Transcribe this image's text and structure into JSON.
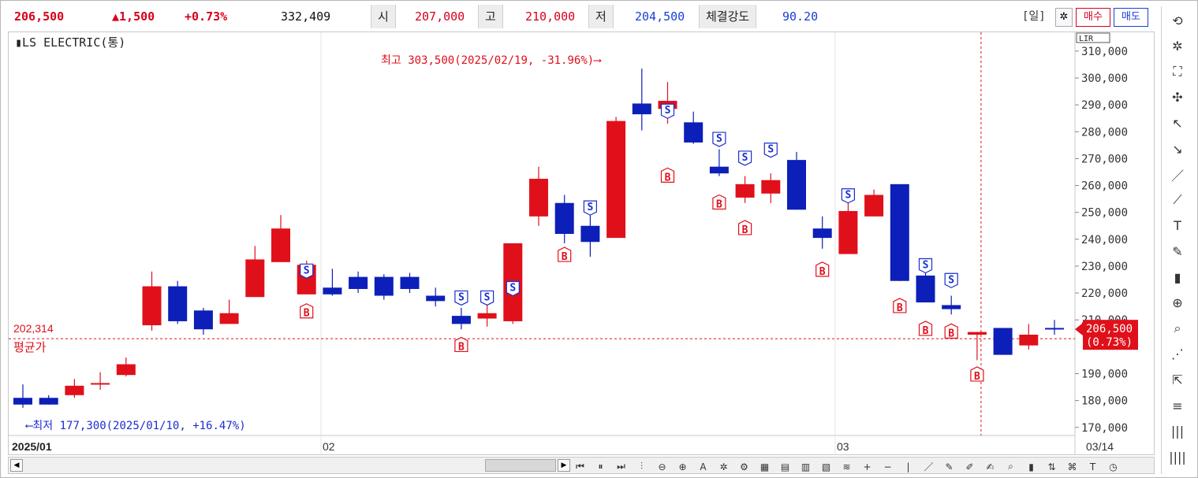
{
  "header": {
    "price": "206,500",
    "change": "▲1,500",
    "change_pct": "+0.73%",
    "volume": "332,409",
    "open_label": "시",
    "open_value": "207,000",
    "high_label": "고",
    "high_value": "210,000",
    "low_label": "저",
    "low_value": "204,500",
    "strength_label": "체결강도",
    "strength_value": "90.20",
    "period_label": "[일]",
    "buy_label": "매수",
    "sell_label": "매도"
  },
  "chart_data": {
    "type": "candlestick",
    "title": "▮LS ELECTRIC(통)",
    "lir": "LIR",
    "y_ticks": [
      "310,000",
      "300,000",
      "290,000",
      "280,000",
      "270,000",
      "260,000",
      "250,000",
      "240,000",
      "230,000",
      "220,000",
      "210,000",
      "190,000",
      "180,000",
      "170,000"
    ],
    "x_labels": [
      "2025/01",
      "02",
      "03",
      "03/14"
    ],
    "ylim": [
      167000,
      317000
    ],
    "candles": [
      {
        "o": 181000,
        "h": 186000,
        "l": 177300,
        "c": 178500
      },
      {
        "o": 181000,
        "h": 182000,
        "l": 178500,
        "c": 178500
      },
      {
        "o": 182000,
        "h": 188000,
        "l": 181000,
        "c": 185500
      },
      {
        "o": 186500,
        "h": 190500,
        "l": 184000,
        "c": 186500
      },
      {
        "o": 189500,
        "h": 196000,
        "l": 189000,
        "c": 193500
      },
      {
        "o": 208000,
        "h": 228000,
        "l": 206000,
        "c": 222500
      },
      {
        "o": 222500,
        "h": 224500,
        "l": 208500,
        "c": 209500
      },
      {
        "o": 213500,
        "h": 214500,
        "l": 204500,
        "c": 206500
      },
      {
        "o": 208500,
        "h": 217500,
        "l": 208500,
        "c": 212500
      },
      {
        "o": 218500,
        "h": 237500,
        "l": 218500,
        "c": 232500
      },
      {
        "o": 231500,
        "h": 249000,
        "l": 231500,
        "c": 244000
      },
      {
        "o": 219500,
        "h": 232000,
        "l": 219500,
        "c": 230500
      },
      {
        "o": 222000,
        "h": 229000,
        "l": 219000,
        "c": 219500
      },
      {
        "o": 226000,
        "h": 228000,
        "l": 220000,
        "c": 221500
      },
      {
        "o": 226000,
        "h": 227000,
        "l": 217500,
        "c": 219000
      },
      {
        "o": 226000,
        "h": 227500,
        "l": 220000,
        "c": 221500
      },
      {
        "o": 219000,
        "h": 222000,
        "l": 215000,
        "c": 217000
      },
      {
        "o": 211500,
        "h": 214500,
        "l": 206500,
        "c": 208500
      },
      {
        "o": 210500,
        "h": 216000,
        "l": 207500,
        "c": 212500
      },
      {
        "o": 209500,
        "h": 238500,
        "l": 208500,
        "c": 238500
      },
      {
        "o": 248500,
        "h": 267000,
        "l": 245000,
        "c": 262500
      },
      {
        "o": 253500,
        "h": 256500,
        "l": 238500,
        "c": 242000
      },
      {
        "o": 245000,
        "h": 249000,
        "l": 233500,
        "c": 239000
      },
      {
        "o": 240500,
        "h": 285500,
        "l": 240500,
        "c": 284000
      },
      {
        "o": 290500,
        "h": 303500,
        "l": 280500,
        "c": 286500
      },
      {
        "o": 288500,
        "h": 298500,
        "l": 283000,
        "c": 291500
      },
      {
        "o": 283500,
        "h": 287500,
        "l": 275500,
        "c": 276000
      },
      {
        "o": 267000,
        "h": 273500,
        "l": 263500,
        "c": 264500
      },
      {
        "o": 255500,
        "h": 263500,
        "l": 253500,
        "c": 260500
      },
      {
        "o": 257000,
        "h": 264500,
        "l": 253500,
        "c": 262000
      },
      {
        "o": 269500,
        "h": 272500,
        "l": 251000,
        "c": 251000
      },
      {
        "o": 244000,
        "h": 248500,
        "l": 236500,
        "c": 240500
      },
      {
        "o": 234500,
        "h": 253500,
        "l": 234500,
        "c": 250500
      },
      {
        "o": 248500,
        "h": 258500,
        "l": 248500,
        "c": 256500
      },
      {
        "o": 260500,
        "h": 260500,
        "l": 224500,
        "c": 224500
      },
      {
        "o": 226500,
        "h": 227500,
        "l": 216500,
        "c": 216500
      },
      {
        "o": 215500,
        "h": 219000,
        "l": 212000,
        "c": 214000
      },
      {
        "o": 204500,
        "h": 205500,
        "l": 195000,
        "c": 205500
      },
      {
        "o": 207000,
        "h": 207000,
        "l": 197000,
        "c": 197000
      },
      {
        "o": 200500,
        "h": 208500,
        "l": 199000,
        "c": 204500
      },
      {
        "o": 207000,
        "h": 210000,
        "l": 204500,
        "c": 206500
      }
    ],
    "signals": [
      {
        "i": 11,
        "t": "S",
        "y": 225500
      },
      {
        "i": 11,
        "t": "B",
        "y": 216000
      },
      {
        "i": 17,
        "t": "S",
        "y": 215500
      },
      {
        "i": 17,
        "t": "B",
        "y": 203500
      },
      {
        "i": 18,
        "t": "S",
        "y": 215500
      },
      {
        "i": 19,
        "t": "S",
        "y": 219000
      },
      {
        "i": 21,
        "t": "B",
        "y": 237000
      },
      {
        "i": 22,
        "t": "S",
        "y": 249000
      },
      {
        "i": 25,
        "t": "S",
        "y": 285000
      },
      {
        "i": 25,
        "t": "B",
        "y": 266500
      },
      {
        "i": 27,
        "t": "S",
        "y": 274500
      },
      {
        "i": 27,
        "t": "B",
        "y": 256500
      },
      {
        "i": 28,
        "t": "S",
        "y": 267500
      },
      {
        "i": 28,
        "t": "B",
        "y": 247000
      },
      {
        "i": 29,
        "t": "S",
        "y": 270500
      },
      {
        "i": 31,
        "t": "B",
        "y": 231500
      },
      {
        "i": 32,
        "t": "S",
        "y": 253500
      },
      {
        "i": 34,
        "t": "B",
        "y": 218000
      },
      {
        "i": 35,
        "t": "S",
        "y": 227500
      },
      {
        "i": 35,
        "t": "B",
        "y": 209500
      },
      {
        "i": 36,
        "t": "S",
        "y": 222000
      },
      {
        "i": 36,
        "t": "B",
        "y": 208500
      },
      {
        "i": 37,
        "t": "B",
        "y": 192500
      }
    ],
    "high_annotation": "최고 303,500(2025/02/19, -31.96%)⟶",
    "low_annotation": "⟵최저 177,300(2025/01/10, +16.47%)",
    "avg_value_label": "202,314",
    "avg_label": "평균가",
    "avg_price": 203000,
    "current_label": "206,500",
    "current_pct": "(0.73%)",
    "current_price": 206500,
    "up_color": "#e0101a",
    "down_color": "#0c1fb8"
  },
  "sidebar_icons": [
    "refresh-icon",
    "gear-icon",
    "chart-icon",
    "crosshair-icon",
    "pointer-icon",
    "select-icon",
    "line-icon",
    "auto-line-icon",
    "text-icon",
    "text-tool-icon",
    "candle-icon",
    "zoom-in-icon",
    "zoom-list-icon",
    "pattern-icon",
    "arrow-icon",
    "fib-icon",
    "bars-icon",
    "bars2-icon"
  ]
}
